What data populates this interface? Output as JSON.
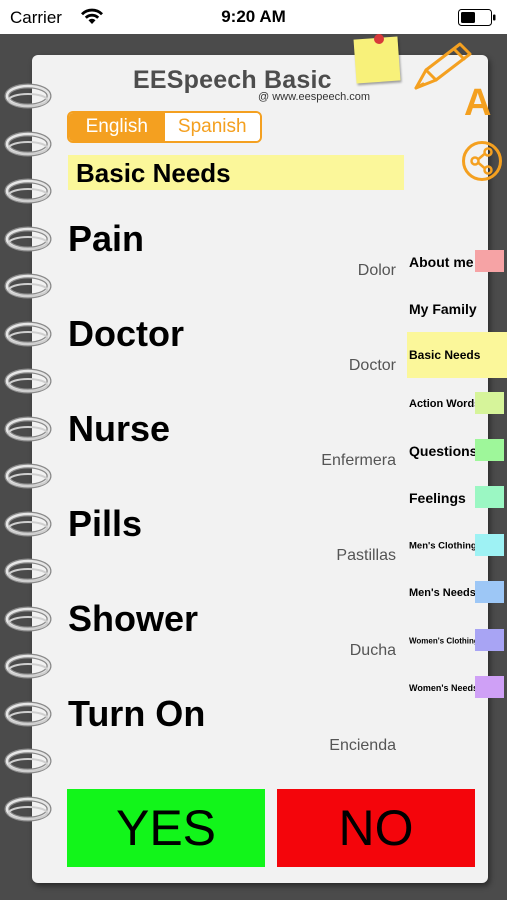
{
  "status": {
    "carrier": "Carrier",
    "time": "9:20 AM"
  },
  "header": {
    "title": "EESpeech Basic",
    "url": "@ www.eespeech.com",
    "font_button": "A"
  },
  "languages": {
    "active": "English",
    "inactive": "Spanish"
  },
  "category": "Basic Needs",
  "phrases": [
    {
      "en": "Pain",
      "es": "Dolor"
    },
    {
      "en": "Doctor",
      "es": "Doctor"
    },
    {
      "en": "Nurse",
      "es": "Enfermera"
    },
    {
      "en": "Pills",
      "es": "Pastillas"
    },
    {
      "en": "Shower",
      "es": "Ducha"
    },
    {
      "en": "Turn On",
      "es": "Encienda"
    }
  ],
  "side_tabs": [
    {
      "label": "About me",
      "color": "#f6a3a5"
    },
    {
      "label": "My Family",
      "color": "#f2f2f2"
    },
    {
      "label": "Basic Needs",
      "color": "#fbf79a",
      "active": true
    },
    {
      "label": "Action Words",
      "color": "#d6f49a"
    },
    {
      "label": "Questions",
      "color": "#9ef79a"
    },
    {
      "label": "Feelings",
      "color": "#9bf7c3"
    },
    {
      "label": "Men's Clothing",
      "color": "#9ef2f4"
    },
    {
      "label": "Men's Needs",
      "color": "#9dc7f6"
    },
    {
      "label": "Women's Clothing",
      "color": "#a8a4f4"
    },
    {
      "label": "Women's Needs",
      "color": "#cfa0f6"
    }
  ],
  "buttons": {
    "yes": "YES",
    "no": "NO"
  },
  "colors": {
    "accent": "#f4a020",
    "yes": "#12f51a",
    "no": "#f4050b",
    "highlight": "#fbf79a"
  }
}
